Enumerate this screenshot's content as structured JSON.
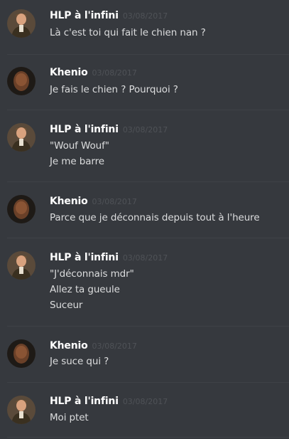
{
  "messages": [
    {
      "author": "HLP à l'infini",
      "avatar": "hlp-avatar",
      "timestamp": "03/08/2017",
      "lines": [
        "Là c'est toi qui fait le chien nan ?"
      ]
    },
    {
      "author": "Khenio",
      "avatar": "khenio-avatar",
      "timestamp": "03/08/2017",
      "lines": [
        "Je fais le chien ? Pourquoi ?"
      ]
    },
    {
      "author": "HLP à l'infini",
      "avatar": "hlp-avatar",
      "timestamp": "03/08/2017",
      "lines": [
        "\"Wouf Wouf\"",
        "Je me barre"
      ]
    },
    {
      "author": "Khenio",
      "avatar": "khenio-avatar",
      "timestamp": "03/08/2017",
      "lines": [
        "Parce que je déconnais depuis tout à l'heure"
      ]
    },
    {
      "author": "HLP à l'infini",
      "avatar": "hlp-avatar",
      "timestamp": "03/08/2017",
      "lines": [
        "\"J'déconnais mdr\"",
        "Allez ta gueule",
        "Suceur"
      ]
    },
    {
      "author": "Khenio",
      "avatar": "khenio-avatar",
      "timestamp": "03/08/2017",
      "lines": [
        "Je suce qui ?"
      ]
    },
    {
      "author": "HLP à l'infini",
      "avatar": "hlp-avatar",
      "timestamp": "03/08/2017",
      "lines": [
        "Moi ptet"
      ]
    }
  ],
  "colors": {
    "background": "#36393e",
    "divider": "#3f4247",
    "author": "#ffffff",
    "timestamp": "#4f5257",
    "text": "#dcddde"
  }
}
